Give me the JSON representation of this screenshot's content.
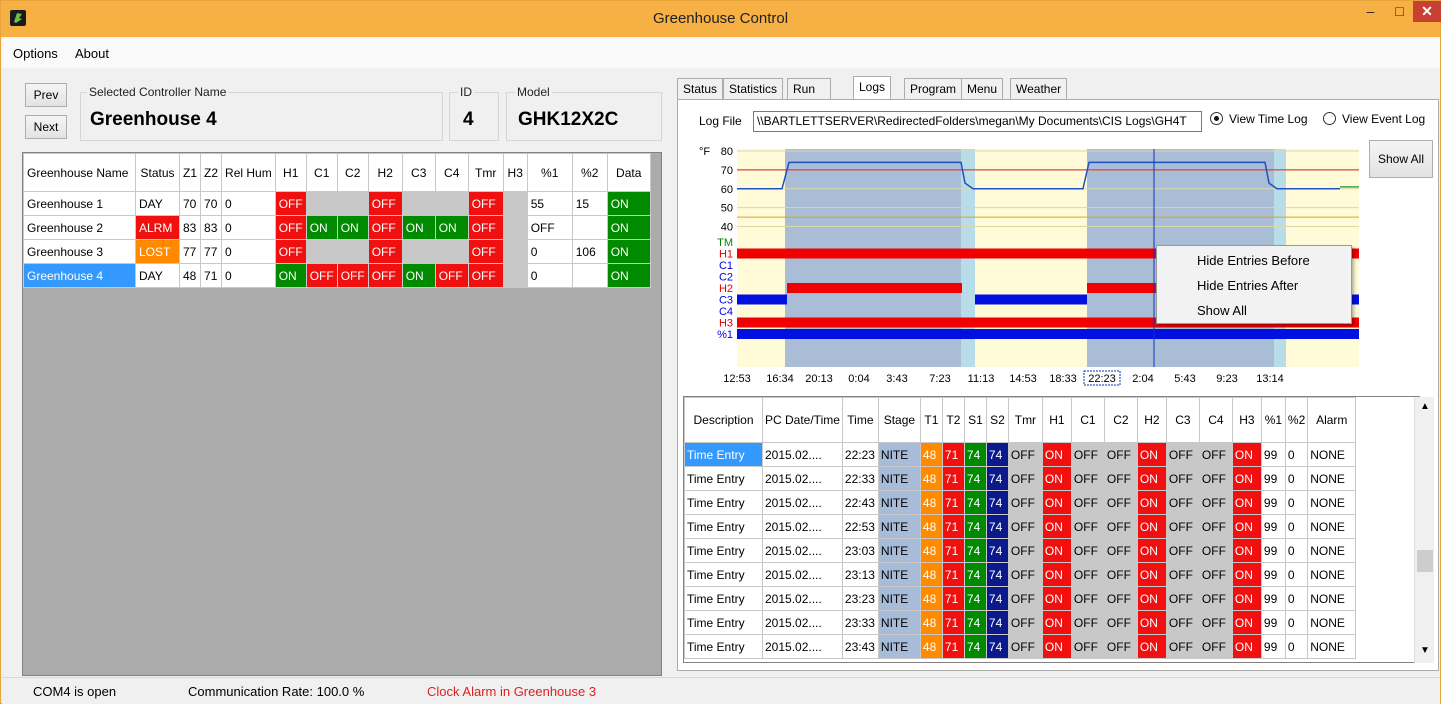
{
  "window": {
    "title": "Greenhouse Control",
    "minimize": "–",
    "maximize": "□",
    "close": "✕"
  },
  "menu": {
    "options": "Options",
    "about": "About"
  },
  "selector": {
    "prev": "Prev",
    "next": "Next",
    "name_legend": "Selected Controller Name",
    "name": "Greenhouse 4",
    "id_legend": "ID",
    "id": "4",
    "model_legend": "Model",
    "model": "GHK12X2C"
  },
  "grid": {
    "headers": [
      "Greenhouse Name",
      "Status",
      "Z1",
      "Z2",
      "Rel Hum",
      "H1",
      "C1",
      "C2",
      "H2",
      "C3",
      "C4",
      "Tmr",
      "H3",
      "%1",
      "%2",
      "Data"
    ],
    "rows": [
      {
        "cells": [
          "Greenhouse 1",
          "DAY",
          "70",
          "70",
          "0",
          "OFF",
          "",
          "",
          "OFF",
          "",
          "",
          "OFF",
          "",
          "55",
          "15",
          "ON"
        ],
        "styles": [
          "",
          "",
          "",
          "",
          "",
          "red",
          "gry",
          "gry",
          "red",
          "gry",
          "gry",
          "red",
          "gry",
          "",
          "",
          "grn"
        ]
      },
      {
        "cells": [
          "Greenhouse 2",
          "ALRM",
          "83",
          "83",
          "0",
          "OFF",
          "ON",
          "ON",
          "OFF",
          "ON",
          "ON",
          "OFF",
          "",
          "OFF",
          "",
          "ON"
        ],
        "styles": [
          "",
          "red",
          "",
          "",
          "",
          "red",
          "grn",
          "grn",
          "red",
          "grn",
          "grn",
          "red",
          "gry",
          "",
          "",
          "grn"
        ]
      },
      {
        "cells": [
          "Greenhouse 3",
          "LOST",
          "77",
          "77",
          "0",
          "OFF",
          "",
          "",
          "OFF",
          "",
          "",
          "OFF",
          "",
          "0",
          "106",
          "ON"
        ],
        "styles": [
          "",
          "org",
          "",
          "",
          "",
          "red",
          "gry",
          "gry",
          "red",
          "gry",
          "gry",
          "red",
          "gry",
          "",
          "",
          "grn"
        ]
      },
      {
        "cells": [
          "Greenhouse 4",
          "DAY",
          "48",
          "71",
          "0",
          "ON",
          "OFF",
          "OFF",
          "OFF",
          "ON",
          "OFF",
          "OFF",
          "",
          "0",
          "",
          "ON"
        ],
        "styles": [
          "sel",
          "",
          "",
          "",
          "",
          "grn",
          "red",
          "red",
          "red",
          "grn",
          "red",
          "red",
          "gry",
          "",
          "",
          "grn"
        ]
      }
    ]
  },
  "tabs": [
    "Status",
    "Statistics",
    "Run Times",
    "Logs",
    "Program",
    "Menu",
    "Weather Sensor"
  ],
  "logs": {
    "log_file_label": "Log File",
    "log_file_path": "\\\\BARTLETTSERVER\\RedirectedFolders\\megan\\My Documents\\CIS Logs\\GH4T",
    "view_time_log": "View Time Log",
    "view_event_log": "View Event Log",
    "show_all": "Show All"
  },
  "chart_data": {
    "type": "line",
    "unit_label": "°F",
    "y_ticks": [
      "80",
      "70",
      "60",
      "50",
      "40"
    ],
    "ylim": [
      35,
      80
    ],
    "reference_lines": [
      {
        "value": 70,
        "color": "#e02020"
      },
      {
        "value": 45,
        "color": "#e0a020"
      }
    ],
    "channel_labels": [
      {
        "label": "TM",
        "color": "#008a00"
      },
      {
        "label": "H1",
        "color": "#e00000"
      },
      {
        "label": "C1",
        "color": "#0000e0"
      },
      {
        "label": "C2",
        "color": "#0000e0"
      },
      {
        "label": "H2",
        "color": "#e00000"
      },
      {
        "label": "C3",
        "color": "#0000e0"
      },
      {
        "label": "C4",
        "color": "#0000e0"
      },
      {
        "label": "H3",
        "color": "#e00000"
      },
      {
        "label": "%1",
        "color": "#0000e0"
      }
    ],
    "x_ticks": [
      "12:53",
      "16:34",
      "20:13",
      "0:04",
      "3:43",
      "7:23",
      "11:13",
      "14:53",
      "18:33",
      "22:23",
      "2:04",
      "5:43",
      "9:23",
      "13:14"
    ],
    "selected_tick": "22:23"
  },
  "context_menu": [
    "Hide Entries Before",
    "Hide Entries After",
    "Show All"
  ],
  "log_table": {
    "headers": [
      "Description",
      "PC Date/Time",
      "Time",
      "Stage",
      "T1",
      "T2",
      "S1",
      "S2",
      "Tmr",
      "H1",
      "C1",
      "C2",
      "H2",
      "C3",
      "C4",
      "H3",
      "%1",
      "%2",
      "Alarm"
    ],
    "rows": [
      [
        "Time Entry",
        "2015.02....",
        "22:23",
        "NITE",
        "48",
        "71",
        "74",
        "74",
        "OFF",
        "ON",
        "OFF",
        "OFF",
        "ON",
        "OFF",
        "OFF",
        "ON",
        "99",
        "0",
        "NONE"
      ],
      [
        "Time Entry",
        "2015.02....",
        "22:33",
        "NITE",
        "48",
        "71",
        "74",
        "74",
        "OFF",
        "ON",
        "OFF",
        "OFF",
        "ON",
        "OFF",
        "OFF",
        "ON",
        "99",
        "0",
        "NONE"
      ],
      [
        "Time Entry",
        "2015.02....",
        "22:43",
        "NITE",
        "48",
        "71",
        "74",
        "74",
        "OFF",
        "ON",
        "OFF",
        "OFF",
        "ON",
        "OFF",
        "OFF",
        "ON",
        "99",
        "0",
        "NONE"
      ],
      [
        "Time Entry",
        "2015.02....",
        "22:53",
        "NITE",
        "48",
        "71",
        "74",
        "74",
        "OFF",
        "ON",
        "OFF",
        "OFF",
        "ON",
        "OFF",
        "OFF",
        "ON",
        "99",
        "0",
        "NONE"
      ],
      [
        "Time Entry",
        "2015.02....",
        "23:03",
        "NITE",
        "48",
        "71",
        "74",
        "74",
        "OFF",
        "ON",
        "OFF",
        "OFF",
        "ON",
        "OFF",
        "OFF",
        "ON",
        "99",
        "0",
        "NONE"
      ],
      [
        "Time Entry",
        "2015.02....",
        "23:13",
        "NITE",
        "48",
        "71",
        "74",
        "74",
        "OFF",
        "ON",
        "OFF",
        "OFF",
        "ON",
        "OFF",
        "OFF",
        "ON",
        "99",
        "0",
        "NONE"
      ],
      [
        "Time Entry",
        "2015.02....",
        "23:23",
        "NITE",
        "48",
        "71",
        "74",
        "74",
        "OFF",
        "ON",
        "OFF",
        "OFF",
        "ON",
        "OFF",
        "OFF",
        "ON",
        "99",
        "0",
        "NONE"
      ],
      [
        "Time Entry",
        "2015.02....",
        "23:33",
        "NITE",
        "48",
        "71",
        "74",
        "74",
        "OFF",
        "ON",
        "OFF",
        "OFF",
        "ON",
        "OFF",
        "OFF",
        "ON",
        "99",
        "0",
        "NONE"
      ],
      [
        "Time Entry",
        "2015.02....",
        "23:43",
        "NITE",
        "48",
        "71",
        "74",
        "74",
        "OFF",
        "ON",
        "OFF",
        "OFF",
        "ON",
        "OFF",
        "OFF",
        "ON",
        "99",
        "0",
        "NONE"
      ]
    ],
    "styles": [
      "",
      "",
      "",
      "lblue",
      "org",
      "red",
      "grn",
      "dblue",
      "gry",
      "red",
      "gry",
      "gry",
      "red",
      "gry",
      "gry",
      "red",
      "",
      "",
      ""
    ],
    "first_row_selected": true
  },
  "status": {
    "port": "COM4 is open",
    "rate": "Communication Rate: 100.0 %",
    "alarm": "Clock Alarm in Greenhouse 3",
    "alarm_color": "#e02020"
  }
}
